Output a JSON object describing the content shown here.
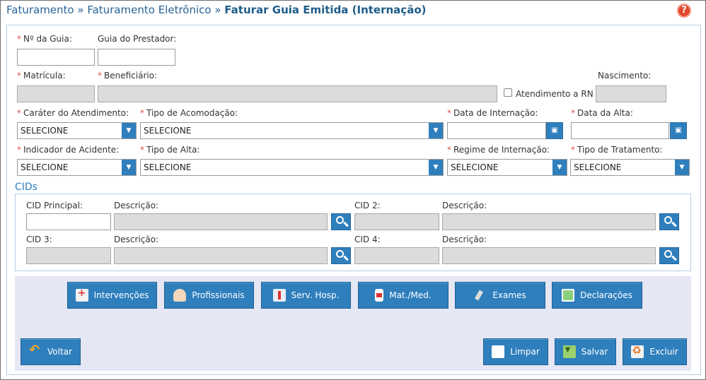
{
  "breadcrumb": {
    "item1": "Faturamento",
    "sep1": " » ",
    "item2": "Faturamento Eletrônico",
    "sep2": " » ",
    "current": "Faturar Guia Emitida (Internação)"
  },
  "help_icon": "?",
  "required_mark": "*",
  "fields": {
    "numero_guia": "Nº da Guia:",
    "guia_prestador": "Guia do Prestador:",
    "matricula": "Matrícula:",
    "beneficiario": "Beneficiário:",
    "nascimento": "Nascimento:",
    "atendimento_rn": "Atendimento a RN",
    "carater_atendimento": "Caráter do Atendimento:",
    "tipo_acomodacao": "Tipo de Acomodação:",
    "data_internacao": "Data de Internação:",
    "data_alta": "Data da Alta:",
    "indicador_acidente": "Indicador de Acidente:",
    "tipo_alta": "Tipo de Alta:",
    "regime_internacao": "Regime de Internação:",
    "tipo_tratamento": "Tipo de Tratamento:"
  },
  "select_default": "SELECIONE",
  "cids": {
    "legend": "CIDs",
    "cid_principal": "CID Principal:",
    "cid2": "CID 2:",
    "cid3": "CID 3:",
    "cid4": "CID 4:",
    "descricao": "Descrição:"
  },
  "buttons": {
    "intervencoes": "Intervenções",
    "profissionais": "Profissionais",
    "serv_hosp": "Serv. Hosp.",
    "mat_med": "Mat./Med.",
    "exames": "Exames",
    "declaracoes": "Declarações",
    "voltar": "Voltar",
    "limpar": "Limpar",
    "salvar": "Salvar",
    "excluir": "Excluir"
  },
  "colors": {
    "accent": "#2f7fbd",
    "required": "#d9534f",
    "toolbar_bg": "#e5e7f4"
  }
}
